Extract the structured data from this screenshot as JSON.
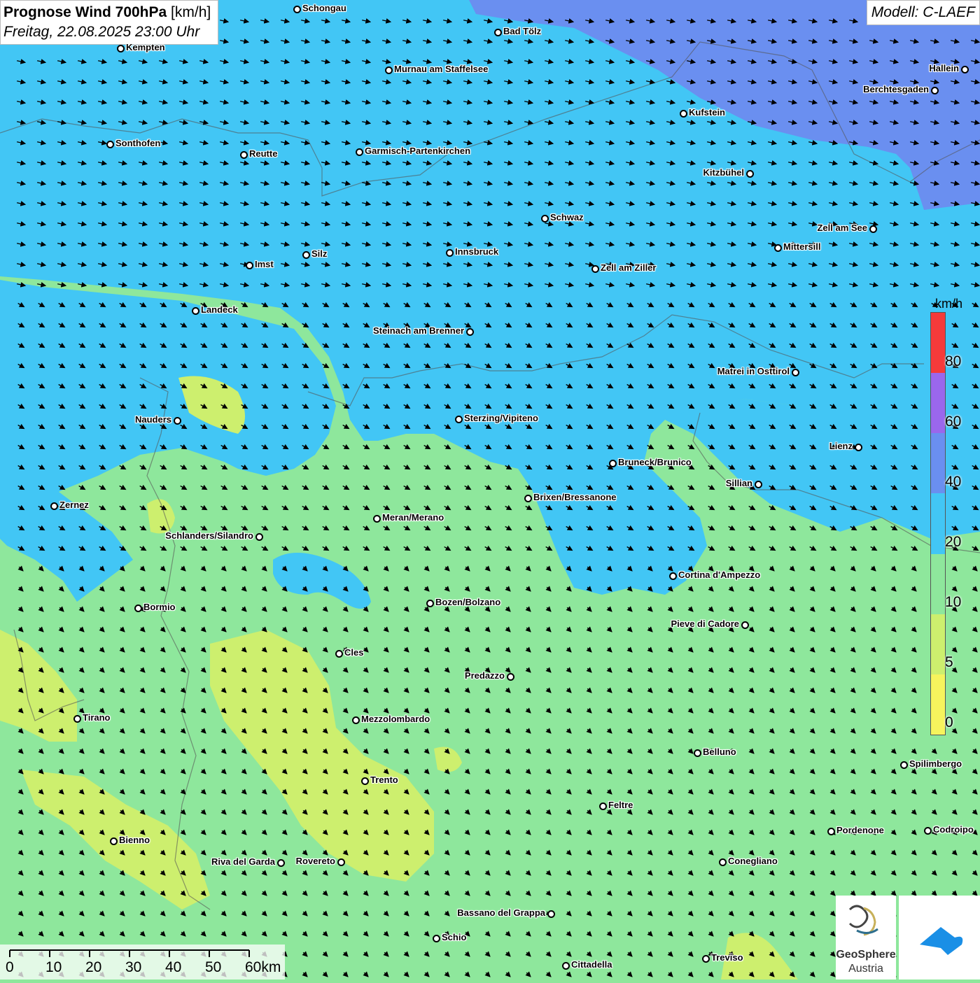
{
  "title": {
    "main_bold": "Prognose Wind 700hPa",
    "main_unit": "[km/h]",
    "date": "Freitag, 22.08.2025 23:00 Uhr"
  },
  "model": "Modell: C-LAEF",
  "legend": {
    "unit": "km/h",
    "labels": [
      "80",
      "60",
      "40",
      "20",
      "10",
      "5",
      "0"
    ],
    "colors": [
      "#f53a3a",
      "#9a67ec",
      "#6a8ff0",
      "#42c6f5",
      "#8ee79c",
      "#cdef6e",
      "#f6f45d"
    ]
  },
  "scale": {
    "labels": [
      "0",
      "10",
      "20",
      "30",
      "40",
      "50",
      "60km"
    ]
  },
  "logos": {
    "geosphere_line1": "GeoSphere",
    "geosphere_line2": "Austria"
  },
  "cities": [
    {
      "name": "Schongau"
    },
    {
      "name": "Bad Tölz"
    },
    {
      "name": "Kempten"
    },
    {
      "name": "Murnau am Staffelsee"
    },
    {
      "name": "Hallein"
    },
    {
      "name": "Berchtesgaden"
    },
    {
      "name": "Kufstein"
    },
    {
      "name": "Sonthofen"
    },
    {
      "name": "Reutte"
    },
    {
      "name": "Garmisch-Partenkirchen"
    },
    {
      "name": "Kitzbühel"
    },
    {
      "name": "Schwaz"
    },
    {
      "name": "Zell am See"
    },
    {
      "name": "Mittersill"
    },
    {
      "name": "Innsbruck"
    },
    {
      "name": "Silz"
    },
    {
      "name": "Imst"
    },
    {
      "name": "Zell am Ziller"
    },
    {
      "name": "Landeck"
    },
    {
      "name": "Steinach am Brenner"
    },
    {
      "name": "Matrei in Osttirol"
    },
    {
      "name": "Nauders"
    },
    {
      "name": "Sterzing/Vipiteno"
    },
    {
      "name": "Lienz"
    },
    {
      "name": "Bruneck/Brunico"
    },
    {
      "name": "Sillian"
    },
    {
      "name": "Zernez"
    },
    {
      "name": "Brixen/Bressanone"
    },
    {
      "name": "Meran/Merano"
    },
    {
      "name": "Schlanders/Silandro"
    },
    {
      "name": "Cortina d'Ampezzo"
    },
    {
      "name": "Bozen/Bolzano"
    },
    {
      "name": "Bormio"
    },
    {
      "name": "Pieve di Cadore"
    },
    {
      "name": "Cles"
    },
    {
      "name": "Predazzo"
    },
    {
      "name": "Tirano"
    },
    {
      "name": "Mezzolombardo"
    },
    {
      "name": "Belluno"
    },
    {
      "name": "Spilimbergo"
    },
    {
      "name": "Trento"
    },
    {
      "name": "Feltre"
    },
    {
      "name": "Bienno"
    },
    {
      "name": "Pordenone"
    },
    {
      "name": "Codroipo"
    },
    {
      "name": "Riva del Garda"
    },
    {
      "name": "Rovereto"
    },
    {
      "name": "Conegliano"
    },
    {
      "name": "Bassano del Grappa"
    },
    {
      "name": "Schio"
    },
    {
      "name": "Treviso"
    },
    {
      "name": "Cittadella"
    }
  ]
}
